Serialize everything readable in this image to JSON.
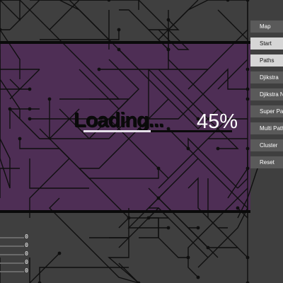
{
  "colors": {
    "background": "#3f3f3f",
    "banner": "#4e2e55",
    "maze_line": "#0f0f0f",
    "node": "#0f0f0f",
    "button": "#5a5a5a",
    "button_active": "#d6d6d6"
  },
  "loading": {
    "label": "Loading...",
    "percent_label": "45%",
    "progress": 0.45
  },
  "sidebar": {
    "items": [
      {
        "label": "Map",
        "active": false
      },
      {
        "label": "Start",
        "active": true
      },
      {
        "label": "Paths",
        "active": true
      },
      {
        "label": "Djikstra",
        "active": false
      },
      {
        "label": "Djikstra No",
        "active": false
      },
      {
        "label": "Super Path",
        "active": false
      },
      {
        "label": "Multi Paths",
        "active": false
      },
      {
        "label": "Cluster",
        "active": false
      },
      {
        "label": "Reset",
        "active": false
      }
    ]
  },
  "stats": {
    "values": [
      "0",
      "0",
      "0",
      "0",
      "0"
    ]
  }
}
